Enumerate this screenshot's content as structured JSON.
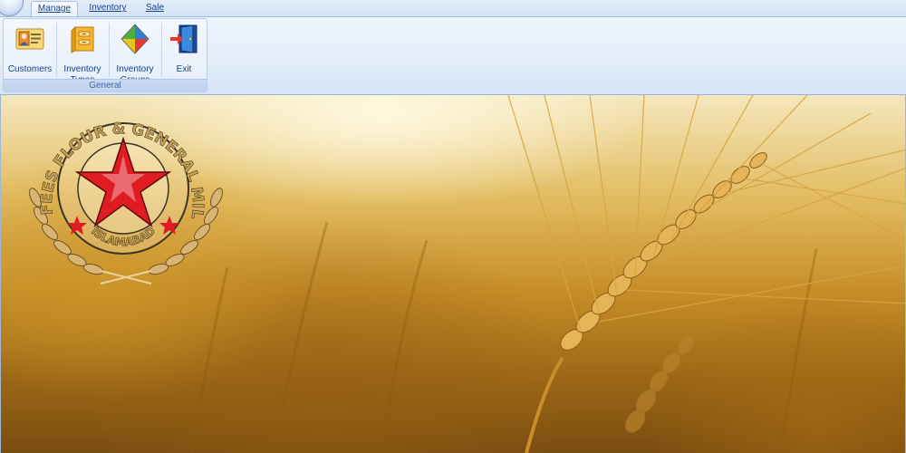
{
  "tabs": [
    {
      "label": "Manage",
      "active": true
    },
    {
      "label": "Inventory",
      "active": false
    },
    {
      "label": "Sale",
      "active": false
    }
  ],
  "ribbon": {
    "group_label": "General",
    "buttons": [
      {
        "label": "Customers",
        "icon": "customer-card-icon"
      },
      {
        "label": "Inventory\nTypes",
        "icon": "inventory-box-icon"
      },
      {
        "label": "Inventory\nGroups",
        "icon": "colored-diamond-icon"
      },
      {
        "label": "Exit",
        "icon": "exit-door-icon"
      }
    ]
  },
  "logo": {
    "arc_text": "NAFEES FLOUR & GENERAL MILLS",
    "city_text": "ISLAMABAD",
    "star_color": "#e11b22"
  },
  "colors": {
    "ribbon_bg": "#e2ecf8",
    "ribbon_text": "#15428b",
    "wheat_gold": "#d8a23a"
  }
}
